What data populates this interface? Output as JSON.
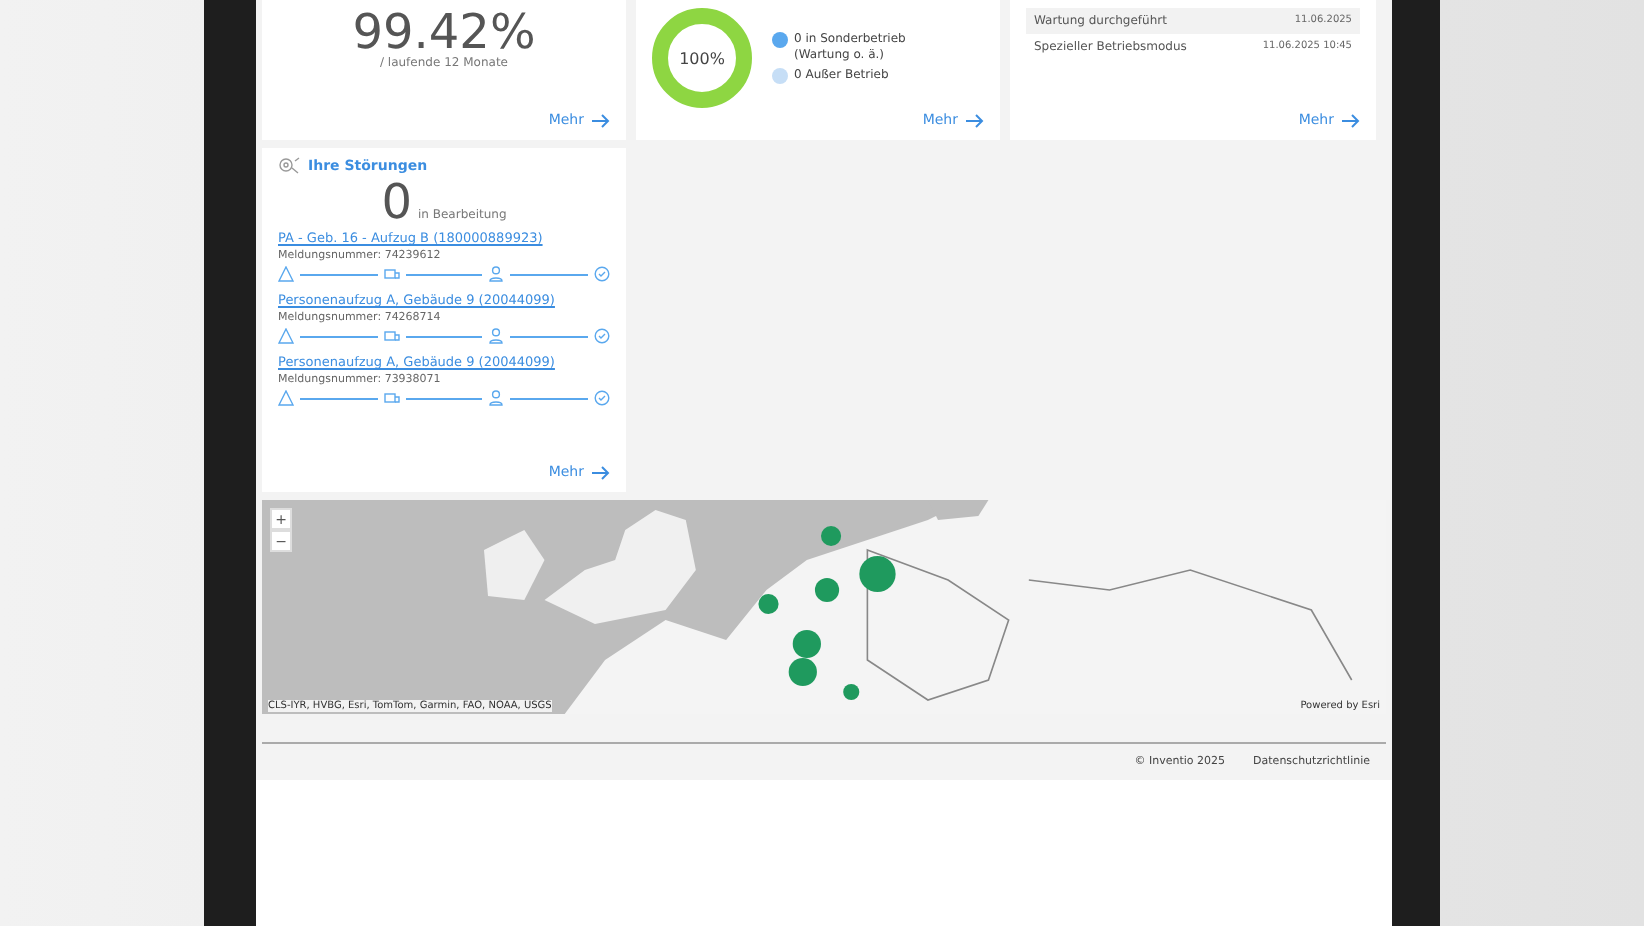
{
  "availability": {
    "value": "99.42%",
    "caption": "/ laufende 12 Monate",
    "more": "Mehr"
  },
  "status": {
    "center": "100%",
    "legend": [
      {
        "label": "0 in Sonderbetrieb (Wartung o. ä.)",
        "color": "#5aa8ee"
      },
      {
        "label": "0 Außer Betrieb",
        "color": "#c6def6"
      }
    ],
    "more": "Mehr"
  },
  "events": {
    "rows": [
      {
        "label": "Wartung durchgeführt",
        "date": "11.06.2025"
      },
      {
        "label": "Spezieller Betriebsmodus",
        "date": "11.06.2025 10:45"
      }
    ],
    "more": "Mehr"
  },
  "faults": {
    "title": "Ihre Störungen",
    "count": "0",
    "count_label": "in Bearbeitung",
    "items": [
      {
        "link": "PA - Geb. 16 - Aufzug B (180000889923)",
        "number": "Meldungsnummer: 74239612"
      },
      {
        "link": "Personenaufzug A, Gebäude 9 (20044099)",
        "number": "Meldungsnummer: 74268714"
      },
      {
        "link": "Personenaufzug A, Gebäude 9 (20044099)",
        "number": "Meldungsnummer: 73938071"
      }
    ],
    "more": "Mehr"
  },
  "map": {
    "zoom_in": "+",
    "zoom_out": "−",
    "attribution": "CLS-IYR, HVBG, Esri, TomTom, Garmin, FAO, NOAA, USGS",
    "powered_by": "Powered by Esri"
  },
  "footer": {
    "copyright": "© Inventio 2025",
    "privacy": "Datenschutzrichtlinie"
  }
}
